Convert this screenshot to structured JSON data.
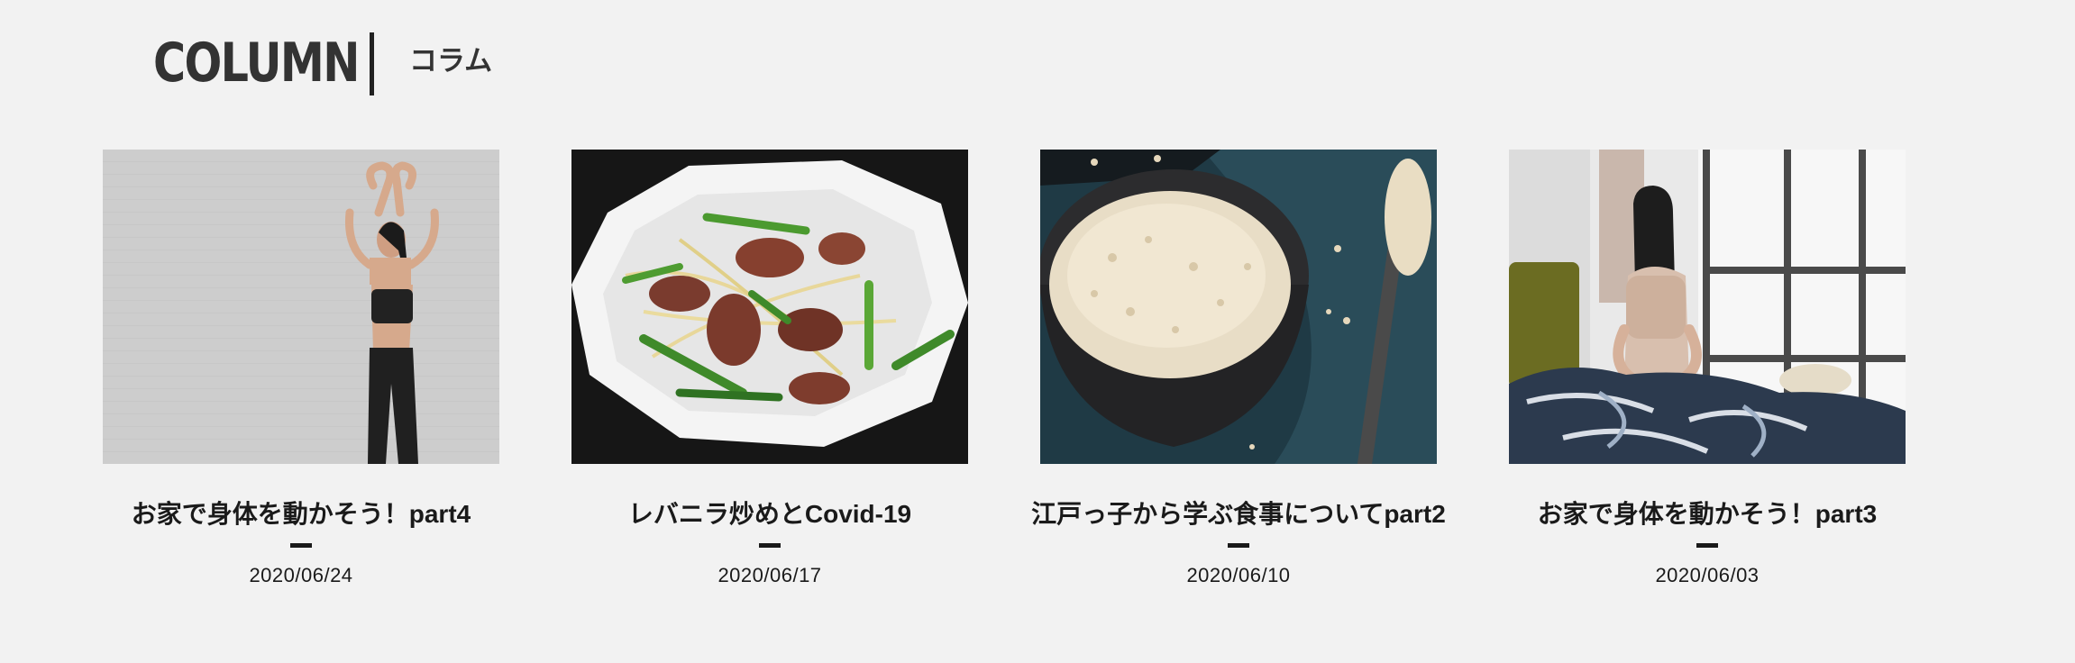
{
  "section": {
    "title": "COLUMN",
    "subtitle": "コラム"
  },
  "articles": [
    {
      "title": "お家で身体を動かそう！part4",
      "date": "2020/06/24",
      "image_icon": "woman-stretching-photo"
    },
    {
      "title": "レバニラ炒めとCovid-19",
      "date": "2020/06/17",
      "image_icon": "liver-and-chives-stir-fry-photo"
    },
    {
      "title": "江戸っ子から学ぶ食事についてpart2",
      "date": "2020/06/10",
      "image_icon": "millet-rice-bowl-photo"
    },
    {
      "title": "お家で身体を動かそう！part3",
      "date": "2020/06/03",
      "image_icon": "woman-back-pain-bedroom-photo"
    }
  ],
  "colors": {
    "background": "#f2f2f2",
    "text": "#1a1a1a",
    "heading": "#333333"
  }
}
